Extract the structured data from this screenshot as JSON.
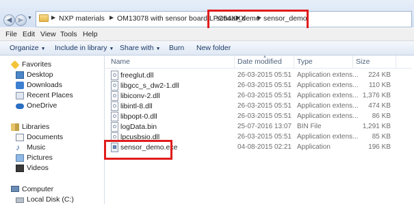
{
  "address": {
    "crumbs": [
      "NXP materials",
      "OM13078 with sensor board LPC54XXX",
      "sensor_demo",
      "sensor_demo"
    ],
    "highlight_color": "#e01b1b"
  },
  "menu": [
    "File",
    "Edit",
    "View",
    "Tools",
    "Help"
  ],
  "toolbar": {
    "organize": "Organize",
    "include": "Include in library",
    "share": "Share with",
    "burn": "Burn",
    "new_folder": "New folder"
  },
  "nav": {
    "favorites": {
      "title": "Favorites",
      "items": [
        "Desktop",
        "Downloads",
        "Recent Places",
        "OneDrive"
      ]
    },
    "libraries": {
      "title": "Libraries",
      "items": [
        "Documents",
        "Music",
        "Pictures",
        "Videos"
      ]
    },
    "computer": {
      "title": "Computer",
      "items": [
        "Local Disk (C:)"
      ]
    }
  },
  "columns": {
    "name": "Name",
    "date": "Date modified",
    "type": "Type",
    "size": "Size"
  },
  "files": [
    {
      "name": "freeglut.dll",
      "date": "26-03-2015 05:51",
      "type": "Application extens...",
      "size": "224 KB"
    },
    {
      "name": "libgcc_s_dw2-1.dll",
      "date": "26-03-2015 05:51",
      "type": "Application extens...",
      "size": "110 KB"
    },
    {
      "name": "libiconv-2.dll",
      "date": "26-03-2015 05:51",
      "type": "Application extens...",
      "size": "1,376 KB"
    },
    {
      "name": "libintl-8.dll",
      "date": "26-03-2015 05:51",
      "type": "Application extens...",
      "size": "474 KB"
    },
    {
      "name": "libpopt-0.dll",
      "date": "26-03-2015 05:51",
      "type": "Application extens...",
      "size": "86 KB"
    },
    {
      "name": "logData.bin",
      "date": "25-07-2016 13:07",
      "type": "BIN File",
      "size": "1,291 KB"
    },
    {
      "name": "lpcusbsio.dll",
      "date": "26-03-2015 05:51",
      "type": "Application extens...",
      "size": "85 KB"
    },
    {
      "name": "sensor_demo.exe",
      "date": "04-08-2015 02:21",
      "type": "Application",
      "size": "196 KB"
    }
  ]
}
